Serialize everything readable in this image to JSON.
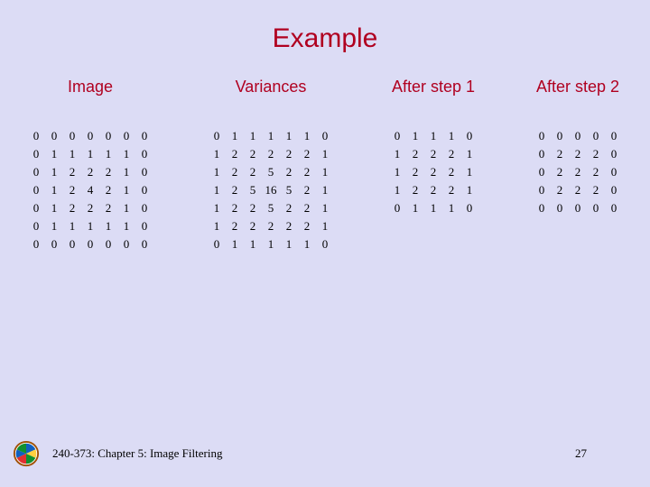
{
  "title": "Example",
  "columns": [
    {
      "heading": "Image",
      "matrix": [
        [
          0,
          0,
          0,
          0,
          0,
          0,
          0
        ],
        [
          0,
          1,
          1,
          1,
          1,
          1,
          0
        ],
        [
          0,
          1,
          2,
          2,
          2,
          1,
          0
        ],
        [
          0,
          1,
          2,
          4,
          2,
          1,
          0
        ],
        [
          0,
          1,
          2,
          2,
          2,
          1,
          0
        ],
        [
          0,
          1,
          1,
          1,
          1,
          1,
          0
        ],
        [
          0,
          0,
          0,
          0,
          0,
          0,
          0
        ]
      ]
    },
    {
      "heading": "Variances",
      "matrix": [
        [
          0,
          1,
          1,
          1,
          1,
          1,
          0
        ],
        [
          1,
          2,
          2,
          2,
          2,
          2,
          1
        ],
        [
          1,
          2,
          2,
          5,
          2,
          2,
          1
        ],
        [
          1,
          2,
          5,
          16,
          5,
          2,
          1
        ],
        [
          1,
          2,
          2,
          5,
          2,
          2,
          1
        ],
        [
          1,
          2,
          2,
          2,
          2,
          2,
          1
        ],
        [
          0,
          1,
          1,
          1,
          1,
          1,
          0
        ]
      ]
    },
    {
      "heading": "After step 1",
      "matrix": [
        [
          0,
          1,
          1,
          1,
          0
        ],
        [
          1,
          2,
          2,
          2,
          1
        ],
        [
          1,
          2,
          2,
          2,
          1
        ],
        [
          1,
          2,
          2,
          2,
          1
        ],
        [
          0,
          1,
          1,
          1,
          0
        ]
      ]
    },
    {
      "heading": "After step 2",
      "matrix": [
        [
          0,
          0,
          0,
          0,
          0
        ],
        [
          0,
          2,
          2,
          2,
          0
        ],
        [
          0,
          2,
          2,
          2,
          0
        ],
        [
          0,
          2,
          2,
          2,
          0
        ],
        [
          0,
          0,
          0,
          0,
          0
        ]
      ]
    }
  ],
  "footer": {
    "text": "240-373: Chapter 5: Image Filtering",
    "page": "27"
  }
}
